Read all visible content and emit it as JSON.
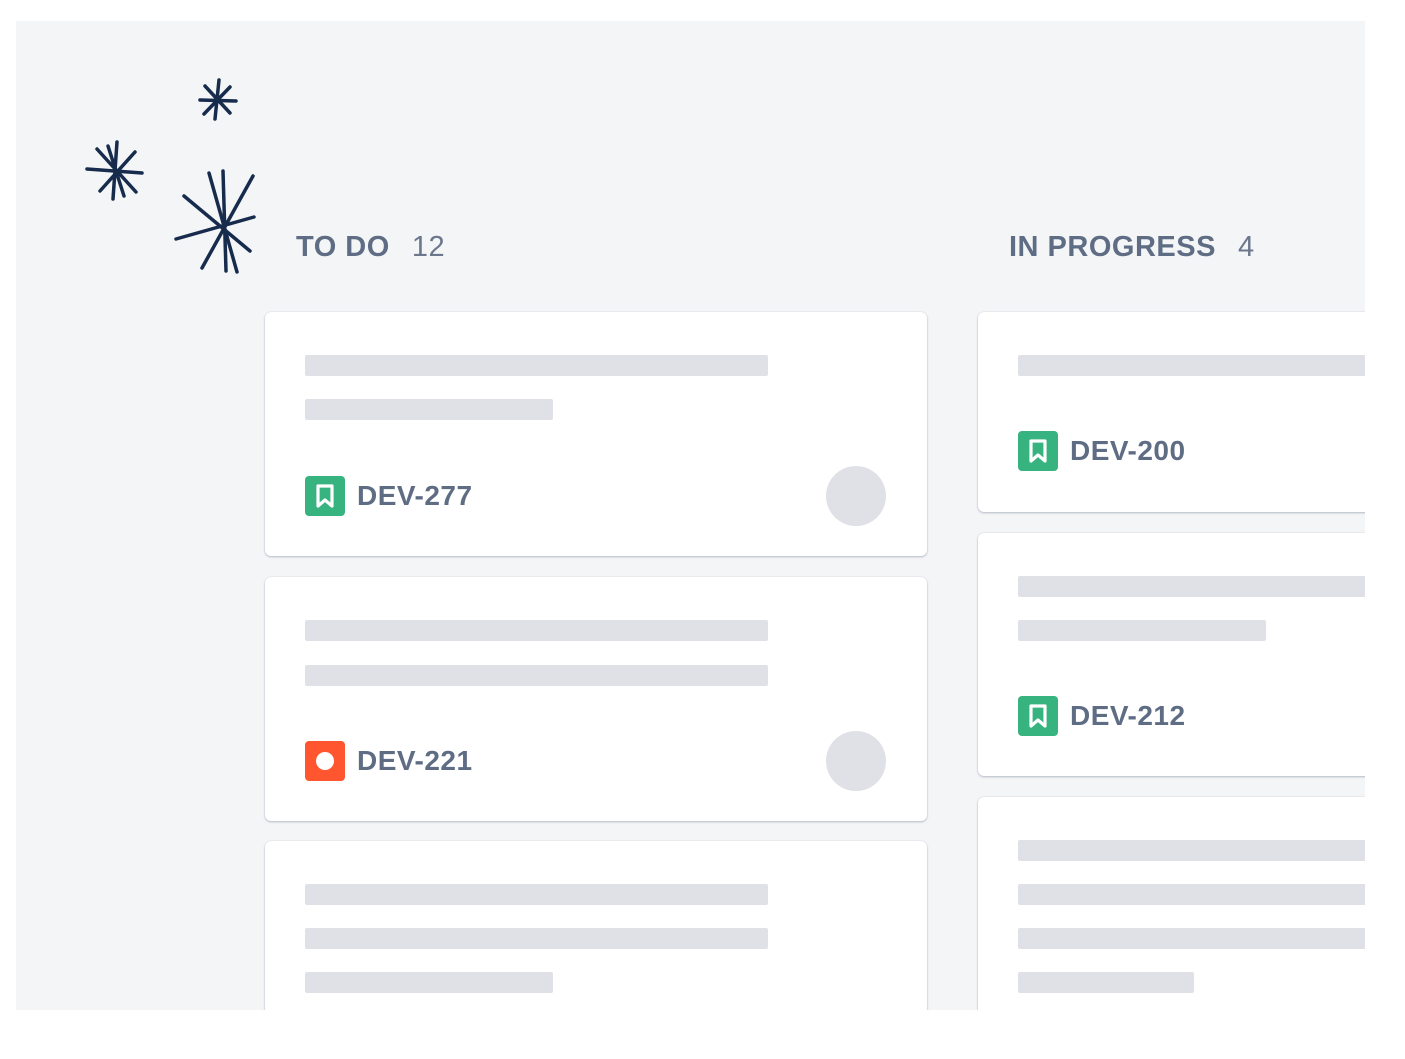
{
  "board": {
    "columns": [
      {
        "title": "TO DO",
        "count": "12",
        "cards": [
          {
            "key": "DEV-277",
            "type": "story"
          },
          {
            "key": "DEV-221",
            "type": "bug"
          },
          {
            "key": "",
            "type": ""
          }
        ]
      },
      {
        "title": "IN PROGRESS",
        "count": "4",
        "cards": [
          {
            "key": "DEV-200",
            "type": "story"
          },
          {
            "key": "DEV-212",
            "type": "story"
          },
          {
            "key": "",
            "type": ""
          }
        ]
      }
    ]
  },
  "colors": {
    "story": "#36b37e",
    "bug": "#ff5630",
    "background": "#f4f5f7",
    "placeholder": "#dfe1e6"
  }
}
